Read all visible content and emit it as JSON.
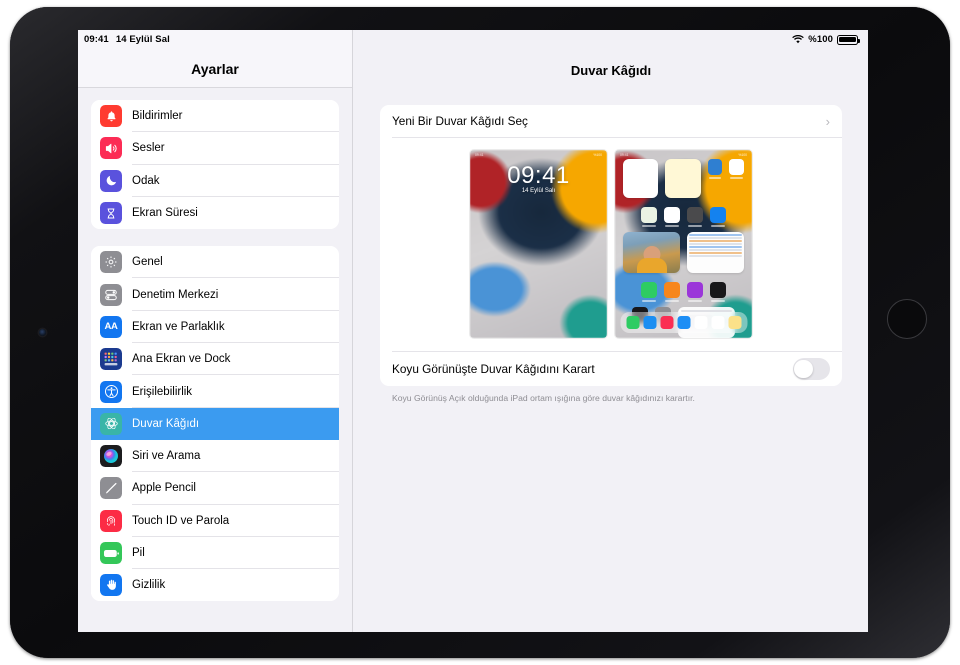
{
  "status_bar": {
    "time": "09:41",
    "date": "14 Eylül Sal",
    "wifi_icon": "wifi-icon",
    "battery_percent": "%100",
    "battery_icon": "battery-full-icon"
  },
  "sidebar": {
    "title": "Ayarlar",
    "groups": [
      {
        "items": [
          {
            "label": "Bildirimler",
            "icon": "bell-icon",
            "color": "#ff3b30",
            "selected": false
          },
          {
            "label": "Sesler",
            "icon": "speaker-icon",
            "color": "#fc2c55",
            "selected": false
          },
          {
            "label": "Odak",
            "icon": "moon-icon",
            "color": "#5a52dd",
            "selected": false
          },
          {
            "label": "Ekran Süresi",
            "icon": "hourglass-icon",
            "color": "#5a52dd",
            "selected": false
          }
        ]
      },
      {
        "items": [
          {
            "label": "Genel",
            "icon": "gear-icon",
            "color": "#8e8e93",
            "selected": false
          },
          {
            "label": "Denetim Merkezi",
            "icon": "toggles-icon",
            "color": "#8e8e93",
            "selected": false
          },
          {
            "label": "Ekran ve Parlaklık",
            "icon": "aa-text-icon",
            "color": "#1276f0",
            "selected": false
          },
          {
            "label": "Ana Ekran ve Dock",
            "icon": "app-grid-icon",
            "color": "#1b3a8f",
            "selected": false
          },
          {
            "label": "Erişilebilirlik",
            "icon": "accessibility-icon",
            "color": "#1276f0",
            "selected": false
          },
          {
            "label": "Duvar Kâğıdı",
            "icon": "wallpaper-flower-icon",
            "color": "#39b5a8",
            "selected": true
          },
          {
            "label": "Siri ve Arama",
            "icon": "siri-orb-icon",
            "color": "#1c1c1e",
            "selected": false
          },
          {
            "label": "Apple Pencil",
            "icon": "pencil-icon",
            "color": "#8e8e93",
            "selected": false
          },
          {
            "label": "Touch ID ve Parola",
            "icon": "fingerprint-icon",
            "color": "#fc2c45",
            "selected": false
          },
          {
            "label": "Pil",
            "icon": "battery-icon",
            "color": "#34c759",
            "selected": false
          },
          {
            "label": "Gizlilik",
            "icon": "hand-raised-icon",
            "color": "#1276f0",
            "selected": false
          }
        ]
      }
    ]
  },
  "main": {
    "title": "Duvar Kâğıdı",
    "choose_row": {
      "label": "Yeni Bir Duvar Kâğıdı Seç",
      "chevron_icon": "chevron-right-icon"
    },
    "previews": {
      "lock_screen": {
        "name": "lock-screen-preview",
        "time": "09:41",
        "date": "14 Eylül Salı",
        "status_time": "09:41",
        "status_battery": "%100"
      },
      "home_screen": {
        "name": "home-screen-preview",
        "status_time": "09:41",
        "status_battery": "%100"
      }
    },
    "dark_row": {
      "label": "Koyu Görünüşte Duvar Kâğıdını Karart",
      "toggle_state": "off"
    },
    "footnote": "Koyu Görünüş Açık olduğunda iPad ortam ışığına göre duvar kâğıdınızı karartır."
  },
  "colors": {
    "selection_blue": "#3b9bf0",
    "screen_background": "#f2f1f6",
    "card_background": "#ffffff"
  }
}
